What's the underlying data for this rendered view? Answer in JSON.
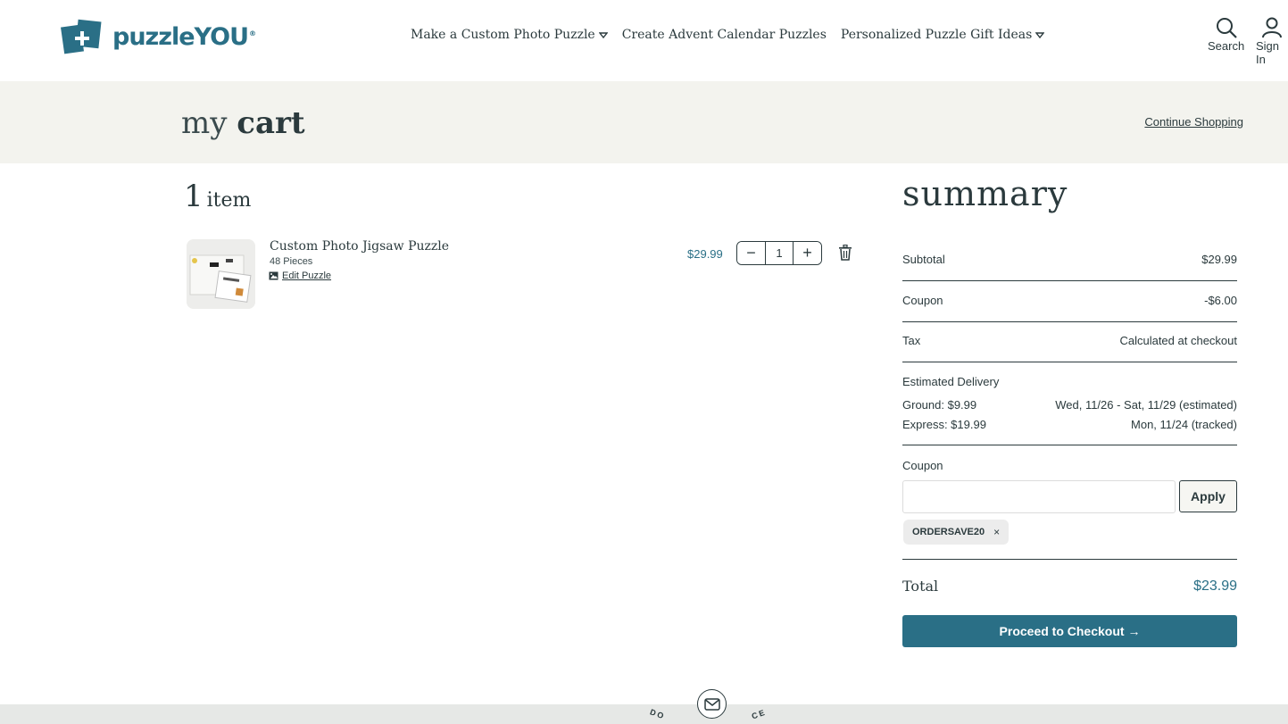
{
  "header": {
    "brand": "puzzleYOU",
    "brand_mark": "®",
    "nav": [
      {
        "label": "Make a Custom Photo Puzzle",
        "has_dropdown": true
      },
      {
        "label": "Create Advent Calendar Puzzles",
        "has_dropdown": false
      },
      {
        "label": "Personalized Puzzle Gift Ideas",
        "has_dropdown": true
      }
    ],
    "search_label": "Search",
    "signin_label": "Sign In"
  },
  "page": {
    "title_light": "my",
    "title_bold": "cart",
    "continue_label": "Continue Shopping"
  },
  "items": {
    "count": "1",
    "count_label": "item",
    "list": [
      {
        "name": "Custom Photo Jigsaw Puzzle",
        "pieces": "48 Pieces",
        "edit_label": "Edit Puzzle",
        "price": "$29.99",
        "qty": "1",
        "minus": "−",
        "plus": "+"
      }
    ]
  },
  "summary": {
    "title": "summary",
    "subtotal_label": "Subtotal",
    "subtotal_value": "$29.99",
    "coupon_label": "Coupon",
    "coupon_value": "-$6.00",
    "tax_label": "Tax",
    "tax_value": "Calculated at checkout",
    "delivery_label": "Estimated Delivery",
    "ground_label": "Ground: $9.99",
    "ground_value": "Wed, 11/26 - Sat, 11/29 (estimated)",
    "express_label": "Express: $19.99",
    "express_value": "Mon, 11/24 (tracked)",
    "coupon_field_label": "Coupon",
    "coupon_input_value": "",
    "apply_label": "Apply",
    "applied_coupon": "ORDERSAVE20",
    "remove_coupon": "×",
    "total_label": "Total",
    "total_value": "$23.99",
    "checkout_label": "Proceed to Checkout →"
  },
  "footer": {
    "left_text": "DO",
    "right_text": "CE"
  },
  "colors": {
    "accent": "#2a6f86",
    "text": "#2b3a3d",
    "band": "#f3f3ee"
  }
}
